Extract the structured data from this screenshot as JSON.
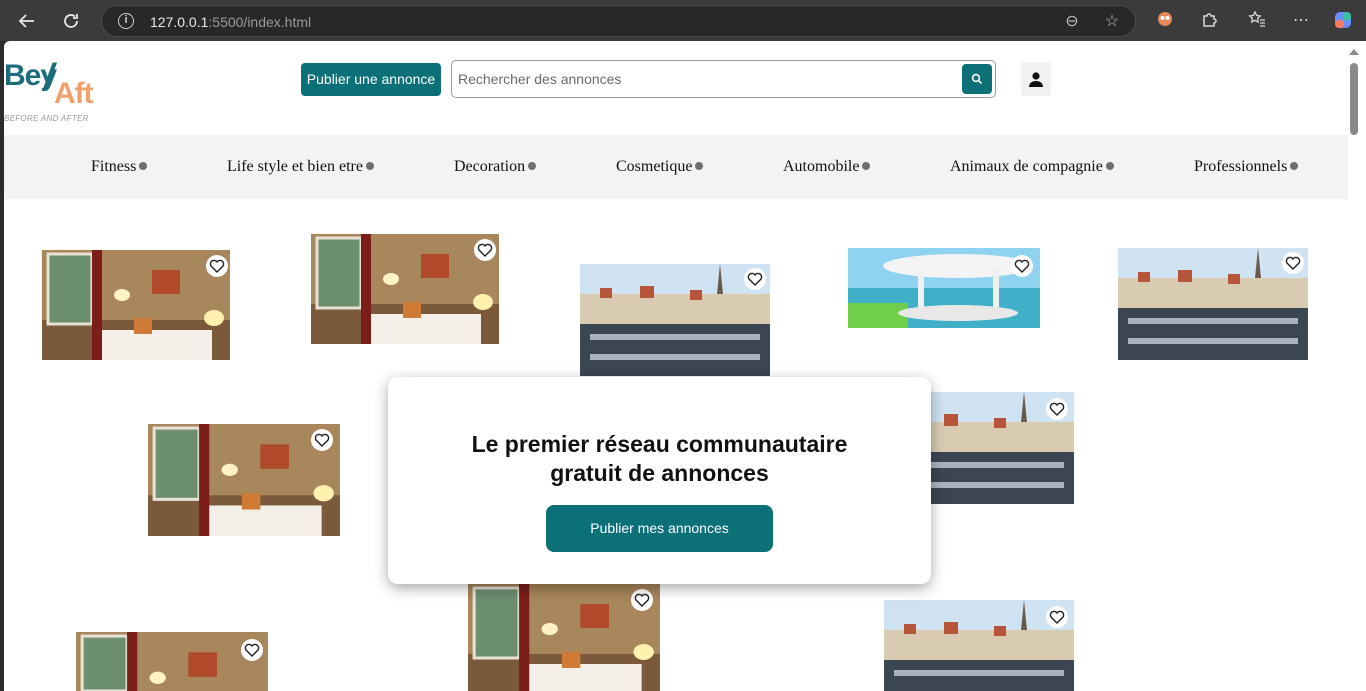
{
  "browser": {
    "url_host": "127.0.0.1",
    "url_rest": ":5500/index.html"
  },
  "header": {
    "logo_top": "Bey",
    "logo_bottom": "Aft",
    "logo_tagline": "BEFORE AND AFTER",
    "publish_label": "Publier une annonce",
    "search_placeholder": "Rechercher des annonces"
  },
  "categories": [
    "Fitness",
    "Life style et bien etre",
    "Decoration",
    "Cosmetique",
    "Automobile",
    "Animaux de compagnie",
    "Professionnels"
  ],
  "modal": {
    "title_line1": "Le premier réseau communautaire",
    "title_line2": "gratuit de annonces",
    "cta_label": "Publier mes annonces"
  },
  "colors": {
    "accent": "#0b7078",
    "logo_teal": "#1c6c7c",
    "logo_orange": "#f0a06a"
  }
}
